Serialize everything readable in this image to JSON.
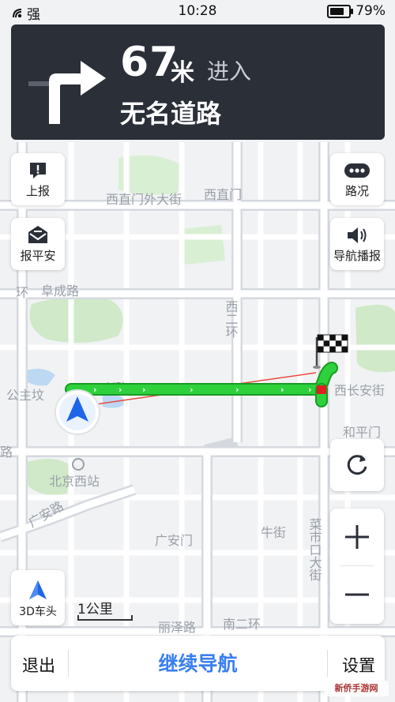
{
  "status_bar": {
    "signal": "强",
    "time": "10:28",
    "battery": "79%"
  },
  "guidance": {
    "distance": "67",
    "unit": "米",
    "action": "进入",
    "road_name": "无名道路"
  },
  "map_labels": {
    "xizhimenwai": "西直门外大街",
    "xizhimen": "西直门",
    "fuchenglu": "阜成路",
    "huan_left": "环",
    "gongzhufen": "公主坟",
    "xinglu": "兴路",
    "xichanganjie": "西长安街",
    "west_2nd_ring": "西二环",
    "hepingmen": "和平门",
    "beijing_west_station": "北京西站",
    "road_left": "路",
    "guanganlu": "广安路",
    "guanganmen": "广安门",
    "niujie": "牛街",
    "caishikoudajie": "菜市口大街",
    "lizeqiao": "丽泽路",
    "south_2nd_ring": "南二环"
  },
  "buttons": {
    "report": "上报",
    "safe": "报平安",
    "traffic": "路况",
    "voice": "导航播报",
    "car_3d": "3D车头",
    "exit": "退出",
    "continue": "继续导航",
    "settings": "设置"
  },
  "scale": "1公里",
  "watermark": "新侨手游网",
  "colors": {
    "route": "#21c530",
    "card": "#2b2f38",
    "accent": "#3a7ff0"
  },
  "icons": [
    "turn-right-icon",
    "report-icon",
    "safe-message-icon",
    "traffic-icon",
    "voice-icon",
    "refresh-icon",
    "zoom-in-icon",
    "zoom-out-icon",
    "3d-car-icon",
    "finish-flag-icon",
    "location-arrow-icon"
  ]
}
